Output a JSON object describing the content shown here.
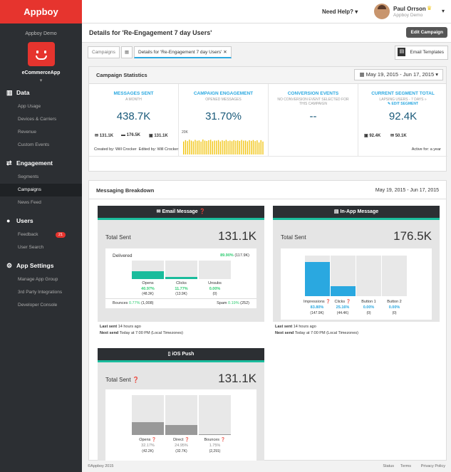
{
  "brand": "Appboy",
  "sidebar": {
    "company": "Appboy Demo",
    "app_name": "eCommerceApp",
    "chevron": "▾",
    "sections": [
      {
        "title": "Data",
        "items": [
          "App Usage",
          "Devices & Carriers",
          "Revenue",
          "Custom Events"
        ]
      },
      {
        "title": "Engagement",
        "items": [
          "Segments",
          "Campaigns",
          "News Feed"
        ]
      },
      {
        "title": "Users",
        "items": [
          "Feedback",
          "User Search"
        ],
        "badge": "21"
      },
      {
        "title": "App Settings",
        "items": [
          "Manage App Group",
          "3rd Party Integrations",
          "Developer Console"
        ]
      }
    ]
  },
  "topbar": {
    "help": "Need Help?",
    "user_name": "Paul Orrson",
    "user_org": "Appboy Demo"
  },
  "page": {
    "title": "Details for 'Re-Engagement 7 day Users'",
    "edit": "Edit Campaign"
  },
  "tabs": {
    "campaigns": "Campaigns",
    "details": "Details for 'Re-Engagement 7 day Users'",
    "close": "✕",
    "email_templates": "Email Templates"
  },
  "stats": {
    "title": "Campaign Statistics",
    "date_range": "May 19, 2015 - Jun 17, 2015",
    "cols": [
      {
        "label": "MESSAGES SENT",
        "sub": "A MONTH",
        "value": "438.7K"
      },
      {
        "label": "CAMPAIGN ENGAGEMENT",
        "sub": "OPENED MESSAGES",
        "value": "31.70%"
      },
      {
        "label": "CONVERSION EVENTS",
        "sub": "NO CONVERSION EVENT SELECTED FOR THIS CAMPAIGN",
        "value": "--"
      },
      {
        "label": "CURRENT SEGMENT TOTAL",
        "sub": "LAPSING USERS - 7 DAYS »",
        "edit": "✎ EDIT SEGMENT",
        "value": "92.4K"
      }
    ],
    "mini_sent": [
      "131.1K",
      "176.5K",
      "131.1K"
    ],
    "chart_label": "20K",
    "seg_counts": [
      "92.4K",
      "50.1K"
    ],
    "created": "Created by: Will Crocker",
    "edited": "Edited by: Will Crocker",
    "active": "Active for: a year"
  },
  "chart_data": {
    "type": "bar",
    "ylim": [
      0,
      20000
    ],
    "values": [
      14000,
      15500,
      14500,
      16000,
      15000,
      14200,
      15800,
      14800,
      15200,
      14000,
      16200,
      15000,
      14600,
      15400,
      15900,
      14300,
      15100,
      14900,
      15600,
      14100,
      15300,
      14700,
      15800,
      14500,
      15000,
      14400,
      15500,
      14800,
      15200,
      14600,
      15700,
      14900,
      15100,
      14200,
      15400,
      14700,
      15600,
      14500,
      15300,
      13000,
      15500,
      14000
    ]
  },
  "breakdown": {
    "title": "Messaging Breakdown",
    "date_range": "May 19, 2015 - Jun 17, 2015",
    "email": {
      "title": "Email Message ❓",
      "total_label": "Total Sent",
      "total": "131.1K",
      "delivered_label": "Delivered",
      "delivered_pct": "89.90%",
      "delivered_n": "(117.9K)",
      "bars": [
        {
          "label": "Opens",
          "pct": "40.97%",
          "n": "(48.3K)",
          "fill": 0.41
        },
        {
          "label": "Clicks",
          "pct": "11.77%",
          "n": "(13.9K)",
          "fill": 0.12
        },
        {
          "label": "Unsubs",
          "pct": "0.00%",
          "n": "(0)",
          "fill": 0
        }
      ],
      "bounces_label": "Bounces",
      "bounces_pct": "0.77%",
      "bounces_n": "(1,008)",
      "spam_label": "Spam",
      "spam_pct": "0.19%",
      "spam_n": "(252)",
      "last_sent_label": "Last sent",
      "last_sent": "14 hours ago",
      "next_send_label": "Next send",
      "next_send": "Today at 7:00 PM (Local Timezones)"
    },
    "inapp": {
      "title": "In-App Message",
      "total_label": "Total Sent",
      "total": "176.5K",
      "bars": [
        {
          "label": "Impressions ❓",
          "pct": "83.80%",
          "n": "(147.9K)",
          "fill": 0.84
        },
        {
          "label": "Clicks ❓",
          "pct": "25.16%",
          "n": "(44.4K)",
          "fill": 0.25
        },
        {
          "label": "Button 1",
          "pct": "0.00%",
          "n": "(0)",
          "fill": 0
        },
        {
          "label": "Button 2",
          "pct": "0.00%",
          "n": "(0)",
          "fill": 0
        }
      ],
      "last_sent_label": "Last sent",
      "last_sent": "14 hours ago",
      "next_send_label": "Next send",
      "next_send": "Today at 7:00 PM (Local Timezones)"
    },
    "ios": {
      "title": "iOS Push",
      "total_label": "Total Sent ❓",
      "total": "131.1K",
      "bars": [
        {
          "label": "Opens ❓",
          "pct": "32.17%",
          "n": "(42.2K)",
          "fill": 0.32
        },
        {
          "label": "Direct ❓",
          "pct": "24.95%",
          "n": "(32.7K)",
          "fill": 0.25
        },
        {
          "label": "Bounces ❓",
          "pct": "1.75%",
          "n": "(2,291)",
          "fill": 0.02
        }
      ]
    }
  },
  "footer": {
    "copyright": "©Appboy 2015",
    "links": [
      "Status",
      "Terms",
      "Privacy Policy"
    ]
  },
  "colors": {
    "brand": "#e6342e",
    "teal": "#1abc9c",
    "blue": "#2aa8e0",
    "gray": "#999999"
  }
}
